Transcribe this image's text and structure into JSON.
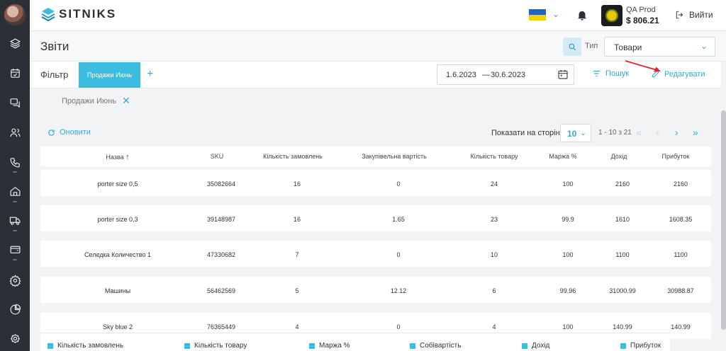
{
  "app": {
    "brand": "SITNIKS"
  },
  "topbar": {
    "store_name": "QA Prod",
    "store_balance": "$ 806.21",
    "logout_label": "Вийти"
  },
  "sidebar": {
    "icons": [
      "layers-icon",
      "calendar-check-icon",
      "chat-icon",
      "users-icon",
      "phone-icon",
      "home-icon",
      "truck-icon",
      "wallet-icon",
      "settings-gear-icon",
      "pie-chart-icon",
      "gear-icon"
    ]
  },
  "header": {
    "title": "Звіти",
    "type_label": "Тип",
    "type_value": "Товари"
  },
  "filter": {
    "label": "Фільтр",
    "active_tab": "Продажи Июнь",
    "add": "+",
    "date_from": "1.6.2023",
    "date_sep": "—",
    "date_to": "30.6.2023",
    "search_label": "Пошук",
    "edit_label": "Редагувати",
    "chip": "Продажи Июнь"
  },
  "controls": {
    "refresh_label": "Оновити",
    "per_page_label": "Показати на сторінці",
    "per_page_value": "10",
    "range": "1 - 10 з 21"
  },
  "table": {
    "columns": [
      "Назва",
      "SKU",
      "Кількість замовлень",
      "Закупівельна вартість",
      "Кількість товару",
      "Маржа %",
      "Дохід",
      "Прибуток"
    ],
    "sort_indicator": "↑",
    "rows": [
      [
        "porter size 0,5",
        "35082664",
        "16",
        "0",
        "24",
        "100",
        "2160",
        "2160"
      ],
      [
        "porter size 0,3",
        "39148987",
        "16",
        "1.65",
        "23",
        "99.9",
        "1610",
        "1608.35"
      ],
      [
        "Селедка Количество 1",
        "47330682",
        "7",
        "0",
        "10",
        "100",
        "1100",
        "1100"
      ],
      [
        "Машины",
        "56462569",
        "5",
        "12.12",
        "6",
        "99.96",
        "31000.99",
        "30988.87"
      ],
      [
        "Sky blue 2",
        "76365449",
        "4",
        "0",
        "4",
        "100",
        "140.99",
        "140.99"
      ]
    ]
  },
  "legend": [
    "Кількість замовлень",
    "Кількість товару",
    "Маржа %",
    "Собівартість",
    "Дохід",
    "Прибуток"
  ],
  "colors": {
    "accent": "#3bbde0",
    "link": "#3aa7d8",
    "sidebar": "#2b3036",
    "arrow": "#e0262c"
  }
}
